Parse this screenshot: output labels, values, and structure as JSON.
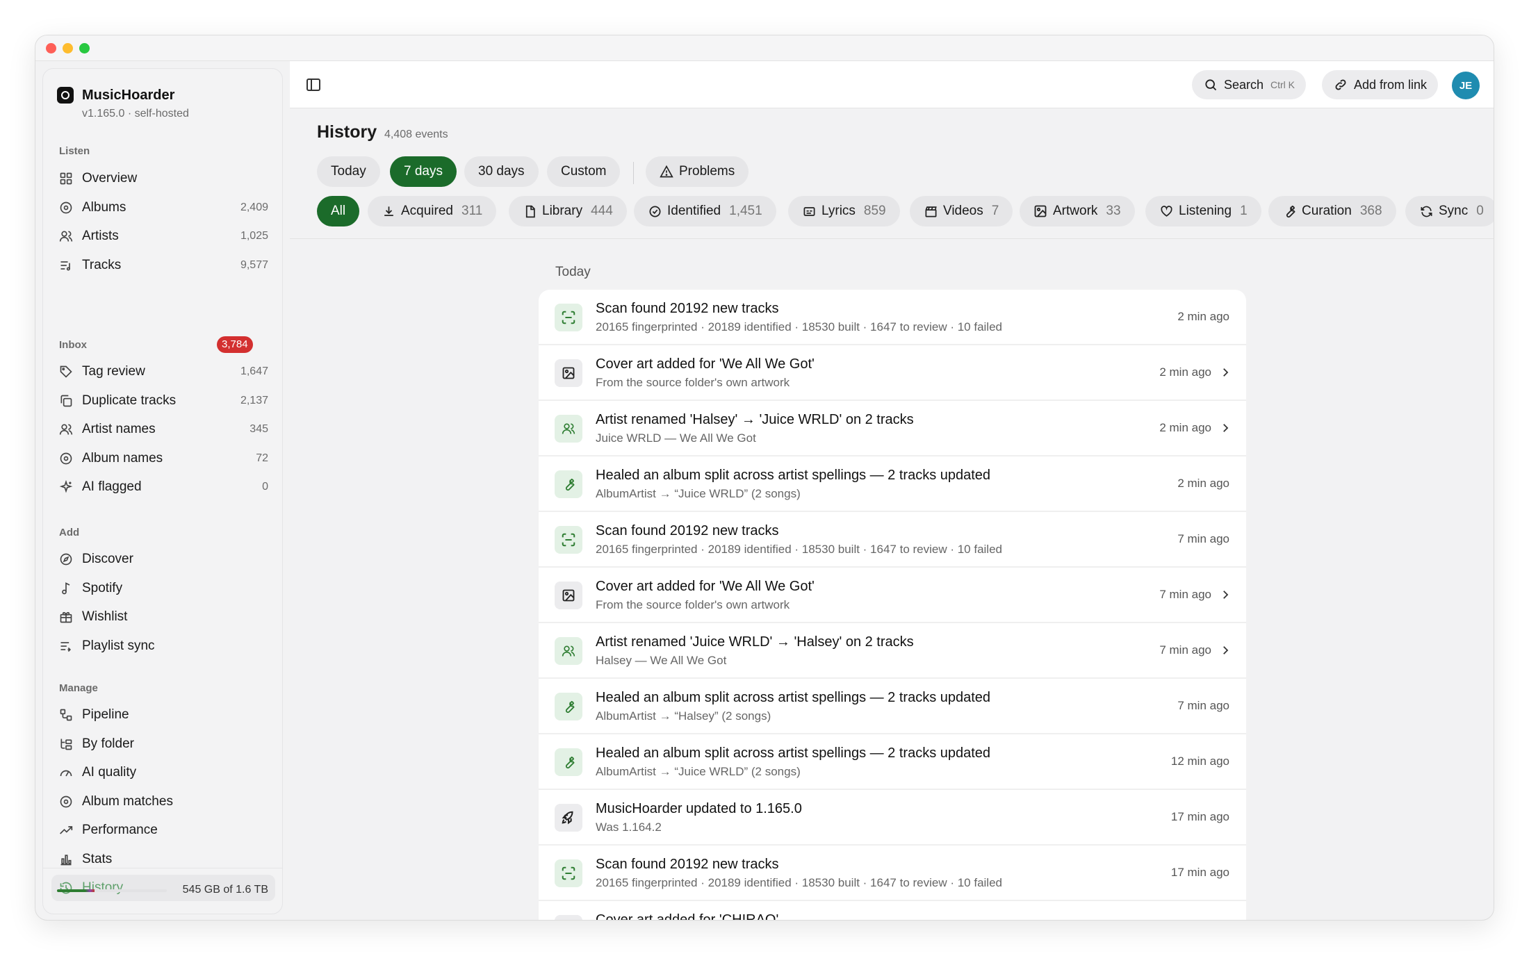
{
  "app": {
    "name": "MusicHoarder",
    "version": "v1.165.0 · self-hosted"
  },
  "sidebar": {
    "listen_label": "Listen",
    "listen": [
      {
        "label": "Overview",
        "count": "",
        "icon": "grid-icon"
      },
      {
        "label": "Albums",
        "count": "2,409",
        "icon": "disc-icon"
      },
      {
        "label": "Artists",
        "count": "1,025",
        "icon": "users-icon"
      },
      {
        "label": "Tracks",
        "count": "9,577",
        "icon": "list-music-icon"
      }
    ],
    "inbox_label": "Inbox",
    "inbox_badge": "3,784",
    "inbox": [
      {
        "label": "Tag review",
        "count": "1,647",
        "icon": "tag-icon"
      },
      {
        "label": "Duplicate tracks",
        "count": "2,137",
        "icon": "copy-icon"
      },
      {
        "label": "Artist names",
        "count": "345",
        "icon": "users-icon"
      },
      {
        "label": "Album names",
        "count": "72",
        "icon": "disc-icon"
      },
      {
        "label": "AI flagged",
        "count": "0",
        "icon": "sparkles-icon"
      }
    ],
    "add_label": "Add",
    "add": [
      {
        "label": "Discover",
        "icon": "compass-icon"
      },
      {
        "label": "Spotify",
        "icon": "music-note-icon"
      },
      {
        "label": "Wishlist",
        "icon": "gift-icon"
      },
      {
        "label": "Playlist sync",
        "icon": "list-sync-icon"
      }
    ],
    "manage_label": "Manage",
    "manage": [
      {
        "label": "Pipeline",
        "icon": "pipeline-icon"
      },
      {
        "label": "By folder",
        "icon": "folder-tree-icon"
      },
      {
        "label": "AI quality",
        "icon": "gauge-icon"
      },
      {
        "label": "Album matches",
        "icon": "disc-icon"
      },
      {
        "label": "Performance",
        "icon": "trend-icon"
      },
      {
        "label": "Stats",
        "icon": "bar-chart-icon"
      },
      {
        "label": "History",
        "icon": "history-icon",
        "active": true
      }
    ],
    "storage": {
      "text": "545 GB of 1.6 TB",
      "used_fraction": 0.34
    }
  },
  "topbar": {
    "search_label": "Search",
    "search_shortcut": "Ctrl K",
    "add_link_label": "Add from link",
    "avatar_initials": "JE"
  },
  "header": {
    "title": "History",
    "subtitle": "4,408 events"
  },
  "range_filters": [
    {
      "label": "Today",
      "active": false
    },
    {
      "label": "7 days",
      "active": true
    },
    {
      "label": "30 days",
      "active": false
    },
    {
      "label": "Custom",
      "active": false
    }
  ],
  "problems_label": "Problems",
  "category_filters": [
    {
      "label": "All",
      "count": "",
      "icon": "",
      "active": true
    },
    {
      "label": "Acquired",
      "count": "311",
      "icon": "download-icon"
    },
    {
      "label": "Library",
      "count": "444",
      "icon": "file-icon"
    },
    {
      "label": "Identified",
      "count": "1,451",
      "icon": "check-circle-icon"
    },
    {
      "label": "Lyrics",
      "count": "859",
      "icon": "captions-icon"
    },
    {
      "label": "Videos",
      "count": "7",
      "icon": "clapperboard-icon"
    },
    {
      "label": "Artwork",
      "count": "33",
      "icon": "image-icon"
    },
    {
      "label": "Listening",
      "count": "1",
      "icon": "heart-icon"
    },
    {
      "label": "Curation",
      "count": "368",
      "icon": "wrench-icon"
    },
    {
      "label": "Sync",
      "count": "0",
      "icon": "refresh-icon"
    }
  ],
  "feed": {
    "day_label": "Today",
    "events": [
      {
        "icon": "scan-icon",
        "tone": "green",
        "title": "Scan found 20192 new tracks",
        "sub": "20165 fingerprinted · 20189 identified · 18530 built · 1647 to review · 10 failed",
        "time": "2 min ago",
        "chevron": false
      },
      {
        "icon": "image-icon",
        "tone": "gray",
        "title": "Cover art added for 'We All We Got'",
        "sub": "From the source folder's own artwork",
        "time": "2 min ago",
        "chevron": true
      },
      {
        "icon": "users-icon",
        "tone": "green",
        "title": "Artist renamed 'Halsey' → 'Juice WRLD' on 2 tracks",
        "sub": "Juice WRLD — We All We Got",
        "time": "2 min ago",
        "chevron": true
      },
      {
        "icon": "wrench-icon",
        "tone": "green",
        "title": "Healed an album split across artist spellings — 2 tracks updated",
        "sub": "AlbumArtist → “Juice WRLD” (2 songs)",
        "time": "2 min ago",
        "chevron": false
      },
      {
        "icon": "scan-icon",
        "tone": "green",
        "title": "Scan found 20192 new tracks",
        "sub": "20165 fingerprinted · 20189 identified · 18530 built · 1647 to review · 10 failed",
        "time": "7 min ago",
        "chevron": false
      },
      {
        "icon": "image-icon",
        "tone": "gray",
        "title": "Cover art added for 'We All We Got'",
        "sub": "From the source folder's own artwork",
        "time": "7 min ago",
        "chevron": true
      },
      {
        "icon": "users-icon",
        "tone": "green",
        "title": "Artist renamed 'Juice WRLD' → 'Halsey' on 2 tracks",
        "sub": "Halsey — We All We Got",
        "time": "7 min ago",
        "chevron": true
      },
      {
        "icon": "wrench-icon",
        "tone": "green",
        "title": "Healed an album split across artist spellings — 2 tracks updated",
        "sub": "AlbumArtist → “Halsey” (2 songs)",
        "time": "7 min ago",
        "chevron": false
      },
      {
        "icon": "wrench-icon",
        "tone": "green",
        "title": "Healed an album split across artist spellings — 2 tracks updated",
        "sub": "AlbumArtist → “Juice WRLD” (2 songs)",
        "time": "12 min ago",
        "chevron": false
      },
      {
        "icon": "rocket-icon",
        "tone": "gray",
        "title": "MusicHoarder updated to 1.165.0",
        "sub": "Was 1.164.2",
        "time": "17 min ago",
        "chevron": false
      },
      {
        "icon": "scan-icon",
        "tone": "green",
        "title": "Scan found 20192 new tracks",
        "sub": "20165 fingerprinted · 20189 identified · 18530 built · 1647 to review · 10 failed",
        "time": "17 min ago",
        "chevron": false
      },
      {
        "icon": "image-icon",
        "tone": "gray",
        "title": "Cover art added for 'CHIRAQ'",
        "sub": "",
        "time": "",
        "chevron": false
      }
    ]
  }
}
